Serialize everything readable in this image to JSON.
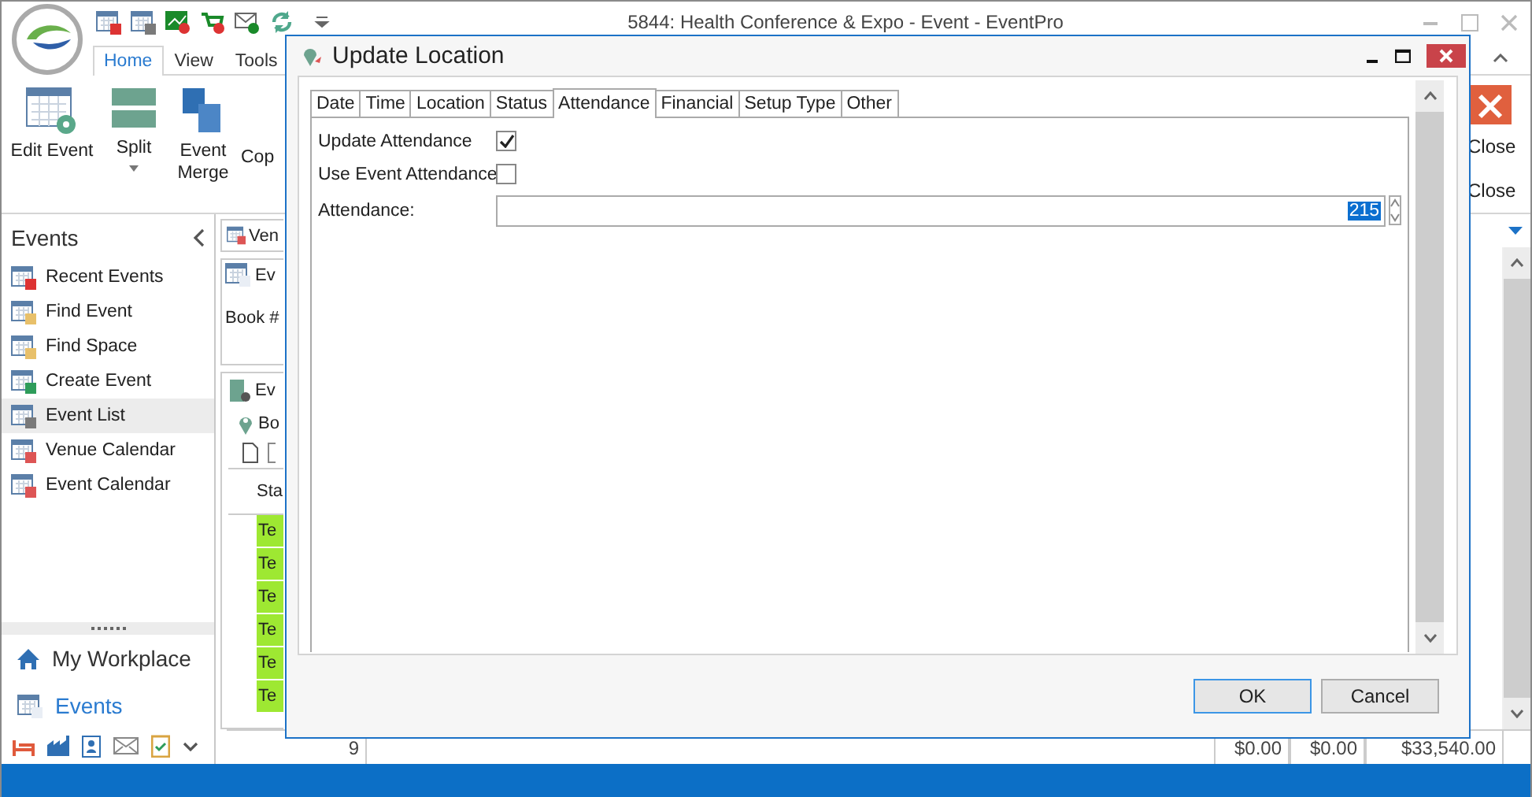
{
  "app": {
    "title": "5844: Health Conference & Expo - Event - EventPro"
  },
  "ribbon": {
    "tabs": [
      {
        "label": "Home",
        "selected": true
      },
      {
        "label": "View",
        "selected": false
      },
      {
        "label": "Tools",
        "selected": false
      }
    ],
    "buttons": [
      {
        "label": "Edit Event",
        "dropdown": false
      },
      {
        "label": "Split",
        "dropdown": true
      },
      {
        "label": "Event Merge",
        "dropdown": false
      },
      {
        "label": "Cop",
        "dropdown": false
      }
    ],
    "right_labels": [
      "Close",
      "Close"
    ]
  },
  "sidebar": {
    "title": "Events",
    "items": [
      {
        "label": "Recent Events",
        "selected": false
      },
      {
        "label": "Find Event",
        "selected": false
      },
      {
        "label": "Find Space",
        "selected": false
      },
      {
        "label": "Create Event",
        "selected": false
      },
      {
        "label": "Event List",
        "selected": true
      },
      {
        "label": "Venue Calendar",
        "selected": false
      },
      {
        "label": "Event Calendar",
        "selected": false
      }
    ],
    "nav": [
      {
        "label": "My Workplace",
        "selected": false
      },
      {
        "label": "Events",
        "selected": true
      }
    ]
  },
  "background": {
    "tab": "Ven",
    "group": "Ev",
    "book_label": "Book #",
    "panel_tab": "Ev",
    "location": "Bo",
    "column": "Sta",
    "status_cells": [
      "Te",
      "Te",
      "Te",
      "Te",
      "Te",
      "Te"
    ],
    "totals": [
      "9",
      "$0.00",
      "$0.00",
      "$33,540.00"
    ]
  },
  "dialog": {
    "title": "Update Location",
    "tabs": [
      {
        "label": "Date",
        "selected": false
      },
      {
        "label": "Time",
        "selected": false
      },
      {
        "label": "Location",
        "selected": false
      },
      {
        "label": "Status",
        "selected": false
      },
      {
        "label": "Attendance",
        "selected": true
      },
      {
        "label": "Financial",
        "selected": false
      },
      {
        "label": "Setup Type",
        "selected": false
      },
      {
        "label": "Other",
        "selected": false
      }
    ],
    "fields": [
      {
        "kind": "checkbox",
        "label": "Update Attendance",
        "checked": true
      },
      {
        "kind": "checkbox",
        "label": "Use Event Attendance",
        "checked": false
      },
      {
        "kind": "number",
        "label": "Attendance:",
        "value": "215"
      }
    ],
    "buttons": [
      "OK",
      "Cancel"
    ]
  }
}
